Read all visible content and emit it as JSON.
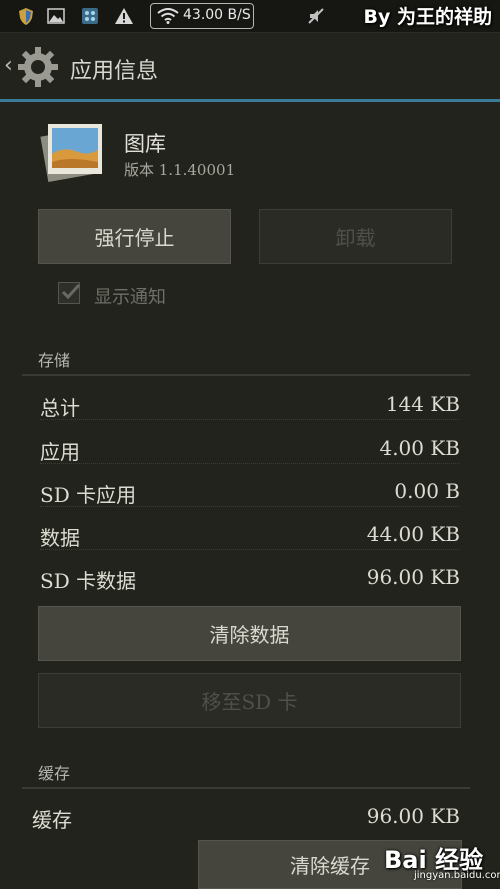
{
  "status_bar": {
    "net_speed": "43.00 B/S",
    "watermark": "By 为王的祥助",
    "icons": [
      "shield-icon",
      "image-notify-icon",
      "app-notify-icon",
      "warning-icon",
      "wifi-icon",
      "mute-icon"
    ]
  },
  "action_bar": {
    "title": "应用信息"
  },
  "app": {
    "name": "图库",
    "version": "版本 1.1.40001"
  },
  "buttons": {
    "force_stop": "强行停止",
    "uninstall": "卸载",
    "clear_data": "清除数据",
    "move_to_sd": "移至SD 卡",
    "clear_cache": "清除缓存"
  },
  "show_notification": {
    "label": "显示通知",
    "checked": true
  },
  "storage": {
    "title": "存储",
    "rows": [
      {
        "label": "总计",
        "value": "144 KB"
      },
      {
        "label": "应用",
        "value": "4.00 KB"
      },
      {
        "label": "SD 卡应用",
        "value": "0.00 B"
      },
      {
        "label": "数据",
        "value": "44.00 KB"
      },
      {
        "label": "SD 卡数据",
        "value": "96.00 KB"
      }
    ]
  },
  "cache": {
    "title": "缓存",
    "rows": [
      {
        "label": "缓存",
        "value": "96.00 KB"
      }
    ]
  },
  "watermark_bottom": {
    "logo": "Bai 经验",
    "url": "jingyan.baidu.com"
  }
}
